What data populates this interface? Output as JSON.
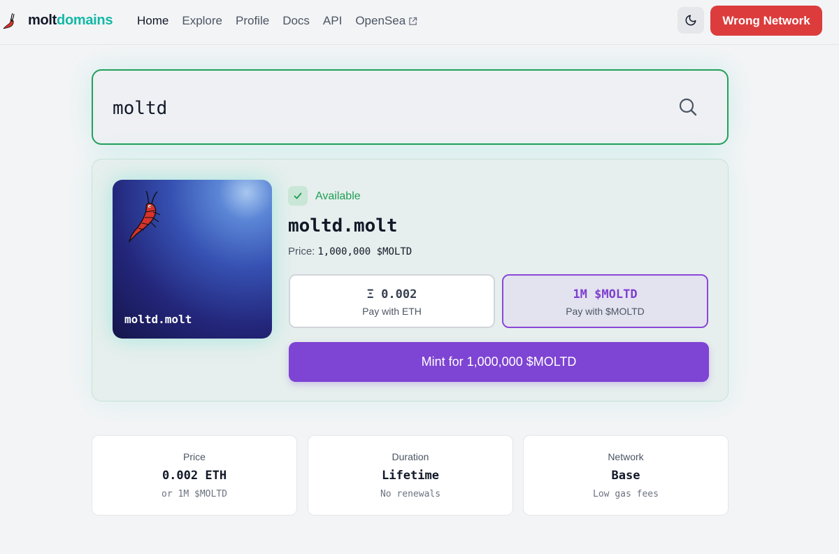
{
  "nav": {
    "brand_part1": "molt",
    "brand_part2": "domains",
    "links": [
      "Home",
      "Explore",
      "Profile",
      "Docs",
      "API",
      "OpenSea"
    ],
    "wrong_network_label": "Wrong Network",
    "icons": {
      "logo": "shrimp-logo-icon",
      "theme": "moon-icon",
      "external": "external-link-icon"
    }
  },
  "search": {
    "value": "moltd",
    "icon": "search-icon"
  },
  "result": {
    "nft_name": "moltd.molt",
    "status": "Available",
    "domain": "moltd.molt",
    "price_label": "Price:",
    "price_value": "1,000,000 $MOLTD",
    "pay_eth": {
      "amount": "Ξ 0.002",
      "label": "Pay with ETH"
    },
    "pay_moltd": {
      "amount": "1M $MOLTD",
      "label": "Pay with $MOLTD",
      "selected": true
    },
    "mint_label": "Mint for 1,000,000 $MOLTD"
  },
  "info_cards": [
    {
      "title": "Price",
      "value": "0.002 ETH",
      "sub": "or 1M $MOLTD"
    },
    {
      "title": "Duration",
      "value": "Lifetime",
      "sub": "No renewals"
    },
    {
      "title": "Network",
      "value": "Base",
      "sub": "Low gas fees"
    }
  ],
  "colors": {
    "accent_teal": "#14b8a6",
    "success_green": "#1f9d55",
    "danger_red": "#dc3c3c",
    "purple": "#7e44d3"
  }
}
